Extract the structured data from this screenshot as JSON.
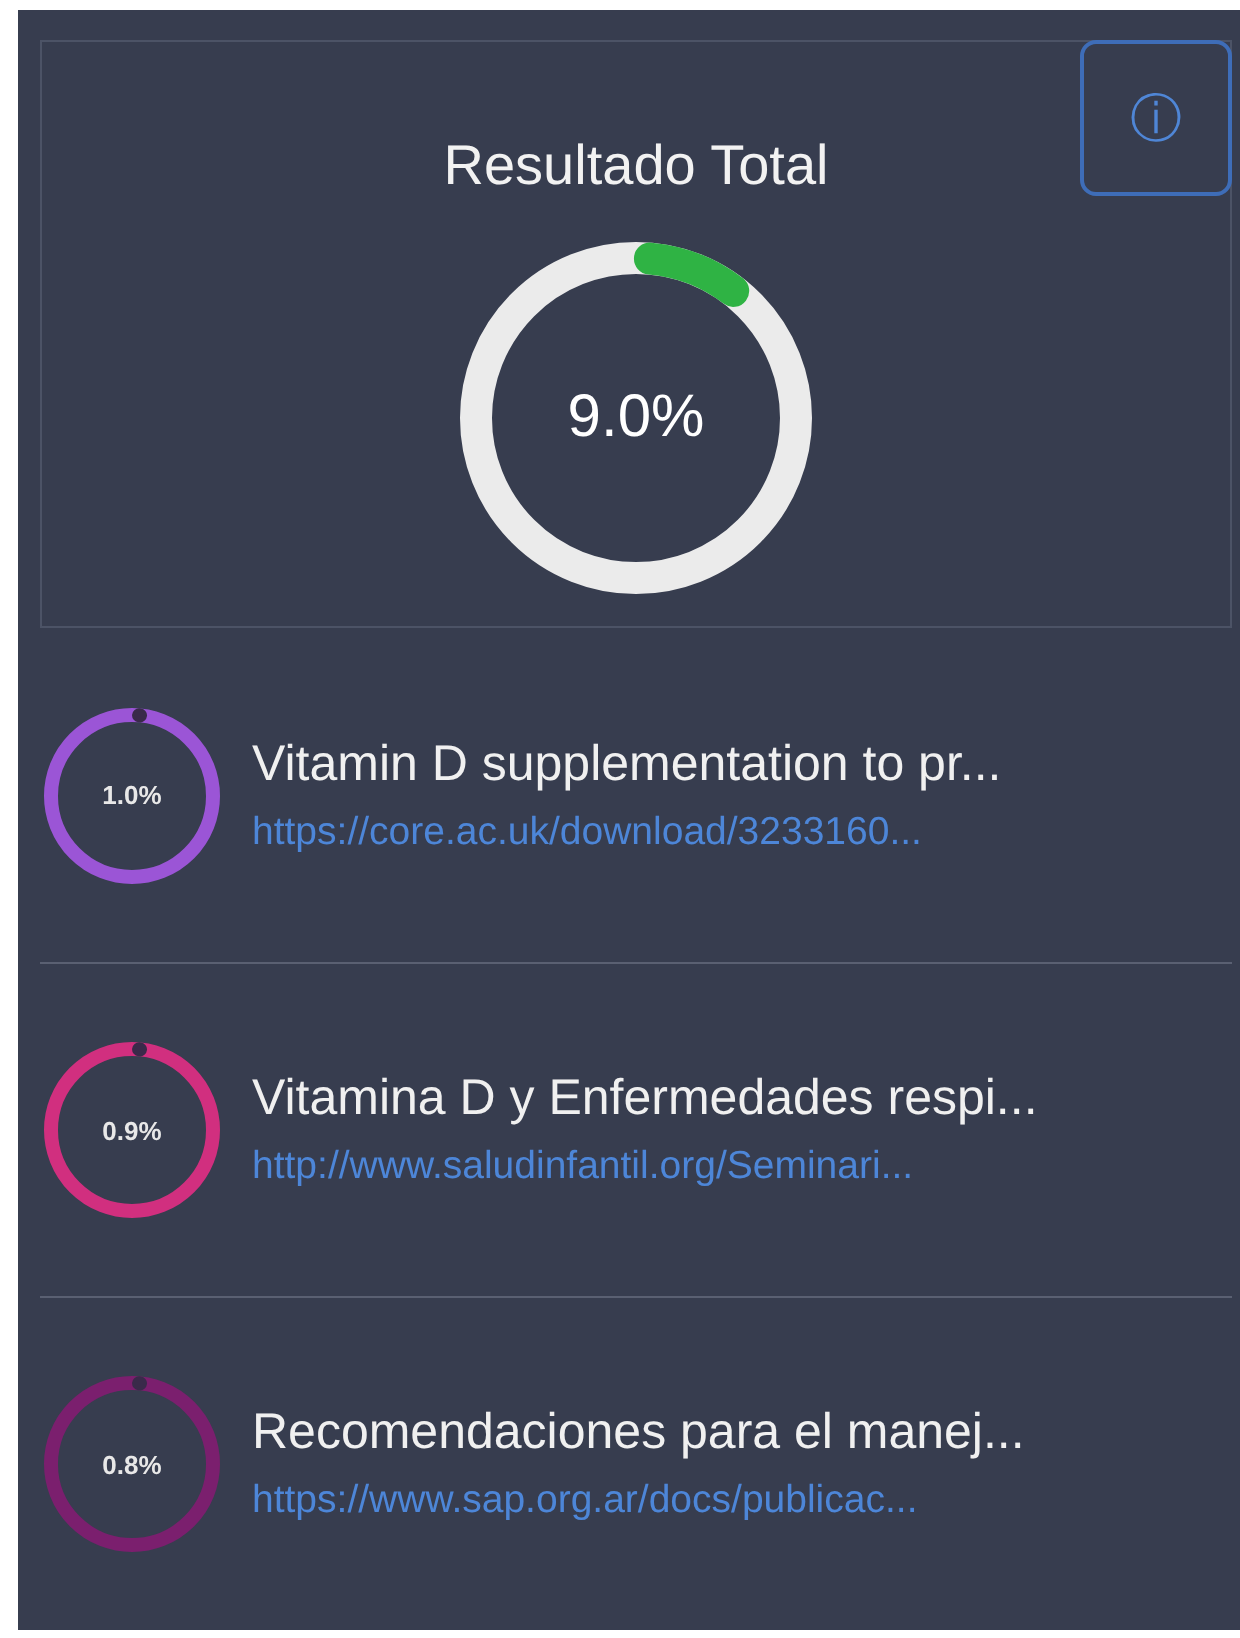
{
  "summary": {
    "title": "Resultado Total",
    "reading": "9.0%",
    "info_button": "ⓘ"
  },
  "results": [
    {
      "reading": "1.0%",
      "color": "#9b55d6",
      "title": "Vitamin D supplementation to pr...",
      "url": "https://core.ac.uk/download/3233160..."
    },
    {
      "reading": "0.9%",
      "color": "#d12f7f",
      "title": "Vitamina D y Enfermedades respi...",
      "url": "http://www.saludinfantil.org/Seminari..."
    },
    {
      "reading": "0.8%",
      "color": "#7b1f6e",
      "title": "Recomendaciones para el manej...",
      "url": "https://www.sap.org.ar/docs/publicac..."
    }
  ]
}
